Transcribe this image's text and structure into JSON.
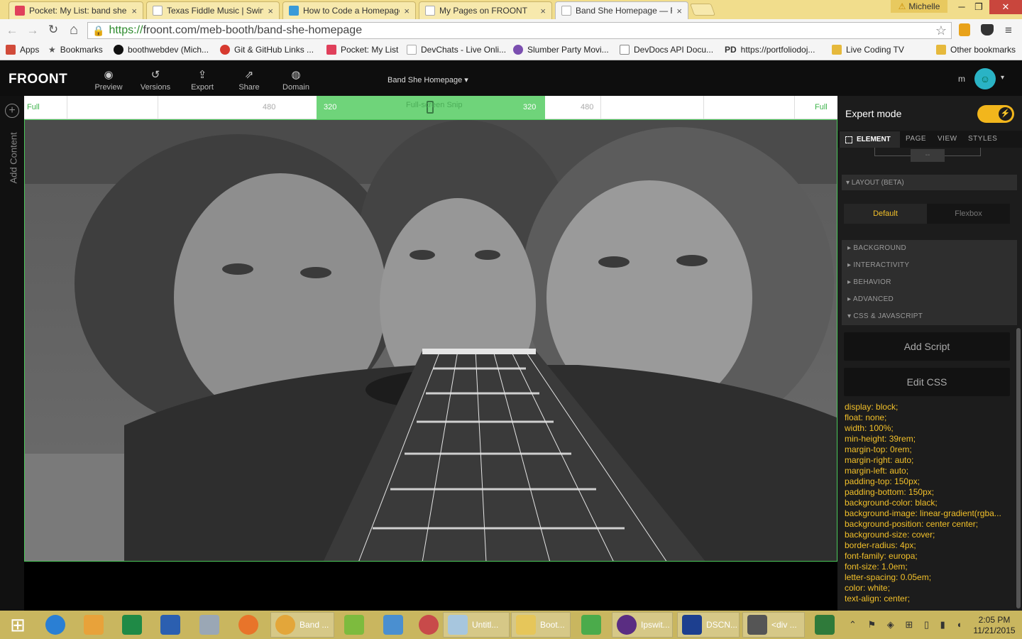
{
  "browser": {
    "tabs": [
      {
        "title": "Pocket: My List: band she",
        "icon_color": "#e0405b"
      },
      {
        "title": "Texas Fiddle Music | Swing",
        "icon_color": "#cccccc"
      },
      {
        "title": "How to Code a Homepage",
        "icon_color": "#3a9ad9"
      },
      {
        "title": "My Pages on FROONT",
        "icon_color": "#cccccc"
      },
      {
        "title": "Band She Homepage — F",
        "icon_color": "#cccccc"
      }
    ],
    "close_glyph": "×",
    "profile_name": "Michelle",
    "window_controls": {
      "minimize": "─",
      "restore": "❐",
      "close": "✕"
    },
    "nav": {
      "back": "←",
      "forward": "→",
      "reload": "↻",
      "home": "⌂"
    },
    "url_scheme": "https://",
    "url_rest": "froont.com/meb-booth/band-she-homepage",
    "lock_glyph": "🔒",
    "star_glyph": "☆",
    "bookmarks": [
      {
        "label": "Apps",
        "icon_color": "#d14b3a"
      },
      {
        "label": "Bookmarks",
        "icon_color": "#555555"
      },
      {
        "label": "boothwebdev (Mich...",
        "icon_color": "#111111"
      },
      {
        "label": "Git & GitHub Links ...",
        "icon_color": "#d73a2f"
      },
      {
        "label": "Pocket: My List",
        "icon_color": "#e0405b"
      },
      {
        "label": "DevChats - Live Onli...",
        "icon_color": "#cccccc"
      },
      {
        "label": "Slumber Party Movi...",
        "icon_color": "#7b4fb0"
      },
      {
        "label": "DevDocs API Docu...",
        "icon_color": "#888888"
      },
      {
        "label": "https://portfoliodoj...",
        "icon_color": "#333333"
      },
      {
        "label": "Live Coding TV",
        "icon_color": "#e6b93c"
      }
    ],
    "other_bookmarks": "Other bookmarks",
    "pd_label": "PD"
  },
  "froont": {
    "logo": "FROONT",
    "toolbar": [
      {
        "label": "Preview",
        "icon": "◉"
      },
      {
        "label": "Versions",
        "icon": "↺"
      },
      {
        "label": "Export",
        "icon": "⇪"
      },
      {
        "label": "Share",
        "icon": "⇗"
      },
      {
        "label": "Domain",
        "icon": "◍"
      }
    ],
    "page_selector": "Band She Homepage ▾",
    "user_initial": "m",
    "avatar_caret": "▾",
    "add_content": "Add Content",
    "add_plus": "+",
    "ruler": {
      "full_left": "Full",
      "left_480": "480",
      "left_320": "320",
      "right_320": "320",
      "right_480": "480",
      "full_right": "Full",
      "snip_text": "Full-screen Snip"
    },
    "panel": {
      "expert_mode": "Expert mode",
      "expert_toggle_glyph": "⚡",
      "tabs": [
        "ELEMENT",
        "PAGE",
        "VIEW",
        "STYLES"
      ],
      "small_btn": "--",
      "layout_section": "▾ LAYOUT (BETA)",
      "layout_options": [
        "Default",
        "Flexbox"
      ],
      "sections": [
        "▸ BACKGROUND",
        "▸ INTERACTIVITY",
        "▸ BEHAVIOR",
        "▸ ADVANCED",
        "▾ CSS & JAVASCRIPT"
      ],
      "add_script": "Add Script",
      "edit_css": "Edit CSS",
      "css_lines": [
        "display: block;",
        "float: none;",
        "width: 100%;",
        "min-height: 39rem;",
        "margin-top: 0rem;",
        "margin-right: auto;",
        "margin-left: auto;",
        "padding-top: 150px;",
        "padding-bottom: 150px;",
        "background-color: black;",
        "background-image: linear-gradient(rgba...",
        "background-position: center center;",
        "background-size: cover;",
        "border-radius: 4px;",
        "font-family: europa;",
        "font-size: 1.0em;",
        "letter-spacing: 0.05em;",
        "color: white;",
        "text-align: center;"
      ],
      "accent": "#f2c02a"
    }
  },
  "taskbar": {
    "windows_glyph": "⊞",
    "items": [
      {
        "label": "",
        "color": "#2a7fd4"
      },
      {
        "label": "",
        "color": "#e8a23a"
      },
      {
        "label": "",
        "color": "#1f8a46"
      },
      {
        "label": "",
        "color": "#2b5fb0"
      },
      {
        "label": "",
        "color": "#9aa7b5"
      },
      {
        "label": "",
        "color": "#e8742a"
      }
    ],
    "windows": [
      {
        "label": "Band ...",
        "color": "#e3a63a"
      },
      {
        "label": "",
        "color": "#7dbb3e"
      },
      {
        "label": "",
        "color": "#4a8fd0"
      },
      {
        "label": "",
        "color": "#c84a4a"
      },
      {
        "label": "Untitl...",
        "color": "#a7c6de"
      },
      {
        "label": "Boot...",
        "color": "#e6c65a"
      },
      {
        "label": "",
        "color": "#4bab4b"
      },
      {
        "label": "Ipswit...",
        "color": "#5a2d82"
      },
      {
        "label": "DSCN...",
        "color": "#1d3f8f"
      },
      {
        "label": "<div ...",
        "color": "#555555"
      },
      {
        "label": "",
        "color": "#2f7a3a"
      }
    ],
    "tray": "⌃ ⚑ ◈ ⊞ ▯ ▮ ◖",
    "time": "2:05 PM",
    "date": "11/21/2015"
  }
}
